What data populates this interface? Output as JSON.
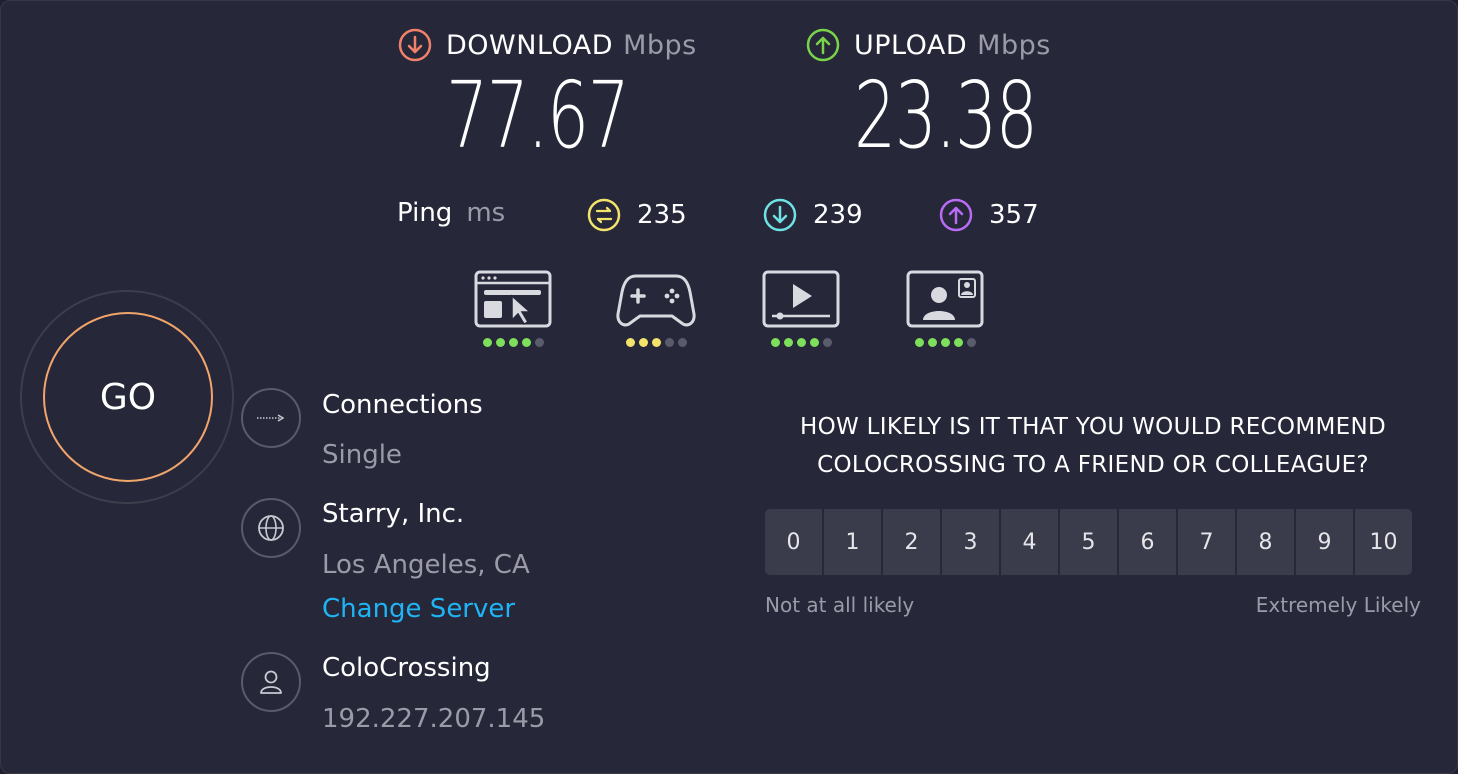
{
  "download": {
    "label": "DOWNLOAD",
    "unit": "Mbps",
    "value": "77.67",
    "color": "#f0826a"
  },
  "upload": {
    "label": "UPLOAD",
    "unit": "Mbps",
    "value": "23.38",
    "color": "#79d44a"
  },
  "ping": {
    "label": "Ping",
    "unit": "ms",
    "idle": {
      "value": "235",
      "color": "#f4e36b"
    },
    "download": {
      "value": "239",
      "color": "#6fe3e3"
    },
    "upload": {
      "value": "357",
      "color": "#b86cf3"
    }
  },
  "quality": [
    {
      "icon": "web-browsing-icon",
      "rating": 4,
      "max": 5,
      "color": "#7ee05a"
    },
    {
      "icon": "gaming-icon",
      "rating": 3,
      "max": 5,
      "color": "#f4e36b"
    },
    {
      "icon": "video-streaming-icon",
      "rating": 4,
      "max": 5,
      "color": "#7ee05a"
    },
    {
      "icon": "video-chat-icon",
      "rating": 4,
      "max": 5,
      "color": "#7ee05a"
    }
  ],
  "go": {
    "label": "GO"
  },
  "connections": {
    "title": "Connections",
    "value": "Single"
  },
  "server": {
    "name": "Starry, Inc.",
    "location": "Los Angeles, CA",
    "change_label": "Change Server"
  },
  "provider": {
    "name": "ColoCrossing",
    "ip": "192.227.207.145"
  },
  "survey": {
    "question": "HOW LIKELY IS IT THAT YOU WOULD RECOMMEND COLOCROSSING TO A FRIEND OR COLLEAGUE?",
    "scale": [
      "0",
      "1",
      "2",
      "3",
      "4",
      "5",
      "6",
      "7",
      "8",
      "9",
      "10"
    ],
    "low_label": "Not at all likely",
    "high_label": "Extremely Likely"
  }
}
